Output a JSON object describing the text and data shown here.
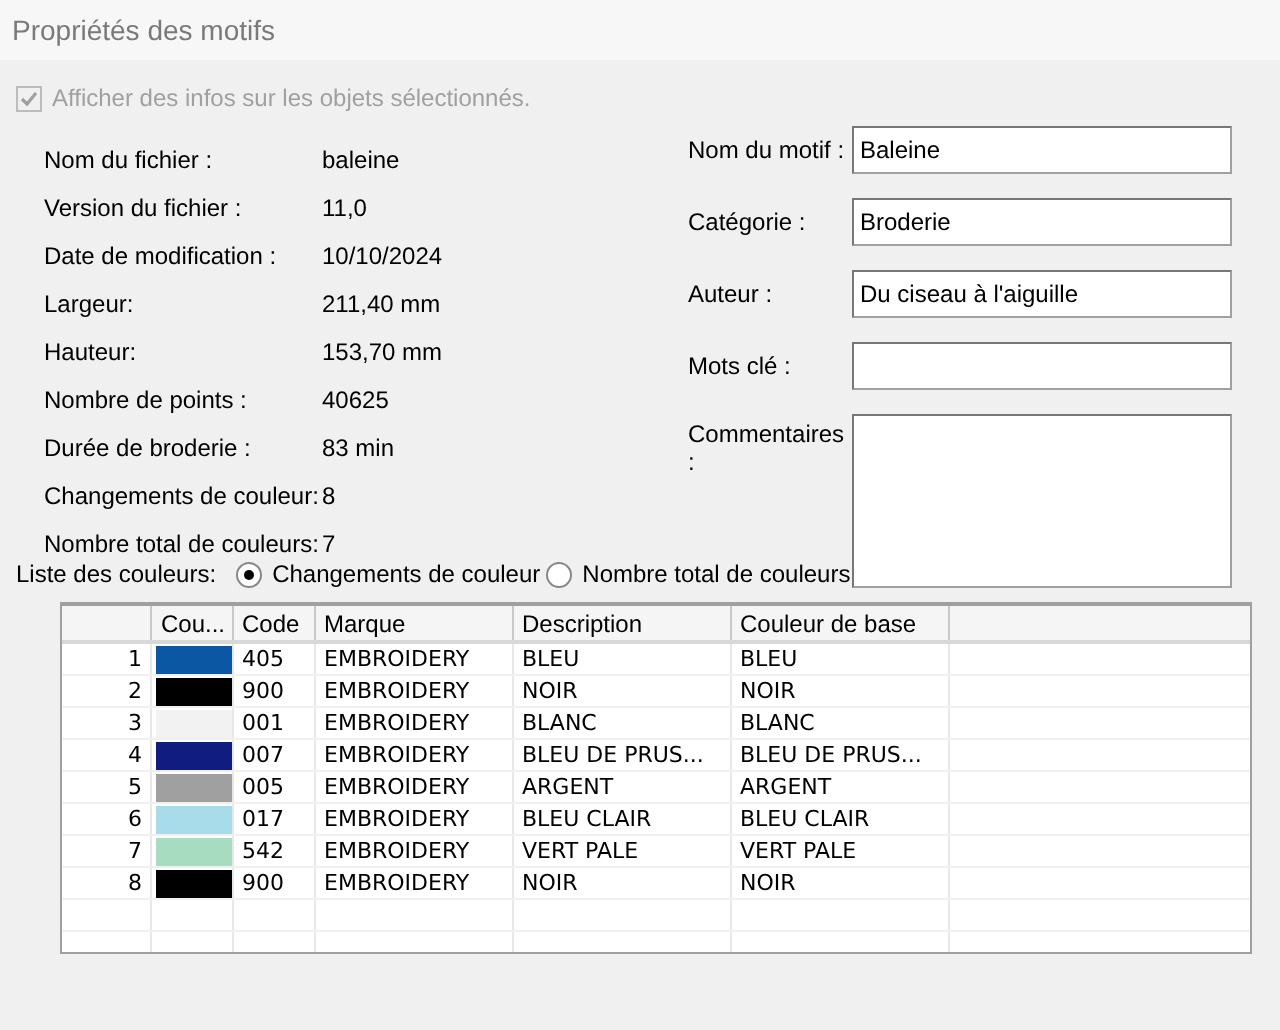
{
  "window": {
    "title": "Propriétés des motifs"
  },
  "show_info": {
    "label": "Afficher des infos sur les objets sélectionnés.",
    "checked": true,
    "disabled": true
  },
  "info": [
    {
      "label": "Nom du fichier :",
      "value": "baleine"
    },
    {
      "label": "Version du fichier :",
      "value": "11,0"
    },
    {
      "label": "Date de modification :",
      "value": "10/10/2024"
    },
    {
      "label": "Largeur:",
      "value": "211,40 mm"
    },
    {
      "label": "Hauteur:",
      "value": "153,70 mm"
    },
    {
      "label": "Nombre de points :",
      "value": "40625"
    },
    {
      "label": "Durée de broderie :",
      "value": "83 min"
    },
    {
      "label": "Changements de couleur:",
      "value": "8"
    },
    {
      "label": "Nombre total de couleurs:",
      "value": "7"
    }
  ],
  "fields": [
    {
      "label": "Nom du motif :",
      "value": "Baleine",
      "kind": "line"
    },
    {
      "label": "Catégorie :",
      "value": "Broderie",
      "kind": "line"
    },
    {
      "label": "Auteur :",
      "value": "Du ciseau à l'aiguille",
      "kind": "line"
    },
    {
      "label": "Mots clé :",
      "kind": "line"
    },
    {
      "label": "Commentaires :",
      "kind": "area"
    }
  ],
  "color_list": {
    "label": "Liste des couleurs:",
    "options": [
      {
        "label": "Changements de couleur",
        "selected": true
      },
      {
        "label": "Nombre total de couleurs",
        "selected": false
      }
    ]
  },
  "table": {
    "columns": [
      "Cou...",
      "Code",
      "Marque",
      "Description",
      "Couleur de base"
    ],
    "rows": [
      {
        "number": "1",
        "color": "#0b57a4",
        "code": "405",
        "brand": "EMBROIDERY",
        "description": "BLEU",
        "base_color": "BLEU"
      },
      {
        "number": "2",
        "color": "#000000",
        "code": "900",
        "brand": "EMBROIDERY",
        "description": "NOIR",
        "base_color": "NOIR"
      },
      {
        "number": "3",
        "color": "#f2f2f2",
        "code": "001",
        "brand": "EMBROIDERY",
        "description": "BLANC",
        "base_color": "BLANC"
      },
      {
        "number": "4",
        "color": "#101c80",
        "code": "007",
        "brand": "EMBROIDERY",
        "description": "BLEU DE PRUS...",
        "base_color": "BLEU DE PRUS..."
      },
      {
        "number": "5",
        "color": "#a0a0a0",
        "code": "005",
        "brand": "EMBROIDERY",
        "description": "ARGENT",
        "base_color": "ARGENT"
      },
      {
        "number": "6",
        "color": "#a8dcea",
        "code": "017",
        "brand": "EMBROIDERY",
        "description": "BLEU CLAIR",
        "base_color": "BLEU CLAIR"
      },
      {
        "number": "7",
        "color": "#a8dcc0",
        "code": "542",
        "brand": "EMBROIDERY",
        "description": "VERT PALE",
        "base_color": "VERT PALE"
      },
      {
        "number": "8",
        "color": "#000000",
        "code": "900",
        "brand": "EMBROIDERY",
        "description": "NOIR",
        "base_color": "NOIR"
      }
    ]
  }
}
